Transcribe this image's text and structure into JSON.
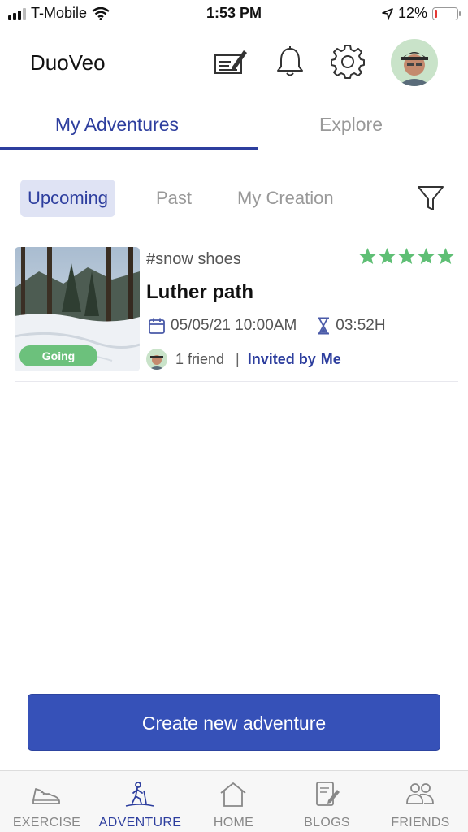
{
  "status_bar": {
    "carrier": "T-Mobile",
    "time": "1:53 PM",
    "battery": "12%",
    "battery_level": 0.12
  },
  "header": {
    "app_title": "DuoVeo",
    "icons": [
      "compose-icon",
      "bell-icon",
      "gear-icon",
      "avatar"
    ]
  },
  "tabs": [
    {
      "label": "My Adventures",
      "active": true
    },
    {
      "label": "Explore",
      "active": false
    }
  ],
  "subtabs": [
    {
      "label": "Upcoming",
      "active": true
    },
    {
      "label": "Past",
      "active": false
    },
    {
      "label": "My Creation",
      "active": false
    }
  ],
  "adventure": {
    "status_badge": "Going",
    "tag": "#snow shoes",
    "rating": 5,
    "title": "Luther path",
    "datetime": "05/05/21 10:00AM",
    "duration": "03:52H",
    "friends": "1 friend",
    "separator": "|",
    "invited_by_label": "Invited by",
    "invited_by": "Me"
  },
  "cta": {
    "label": "Create new adventure"
  },
  "bottom_nav": [
    {
      "label": "EXERCISE",
      "icon": "shoe-icon",
      "active": false
    },
    {
      "label": "ADVENTURE",
      "icon": "hiker-icon",
      "active": true
    },
    {
      "label": "HOME",
      "icon": "home-icon",
      "active": false
    },
    {
      "label": "BLOGS",
      "icon": "blog-icon",
      "active": false
    },
    {
      "label": "FRIENDS",
      "icon": "friends-icon",
      "active": false
    }
  ],
  "colors": {
    "accent": "#2d3e9e",
    "cta": "#3651b8",
    "stars": "#5fbf75",
    "going_badge": "#6cc17c"
  }
}
